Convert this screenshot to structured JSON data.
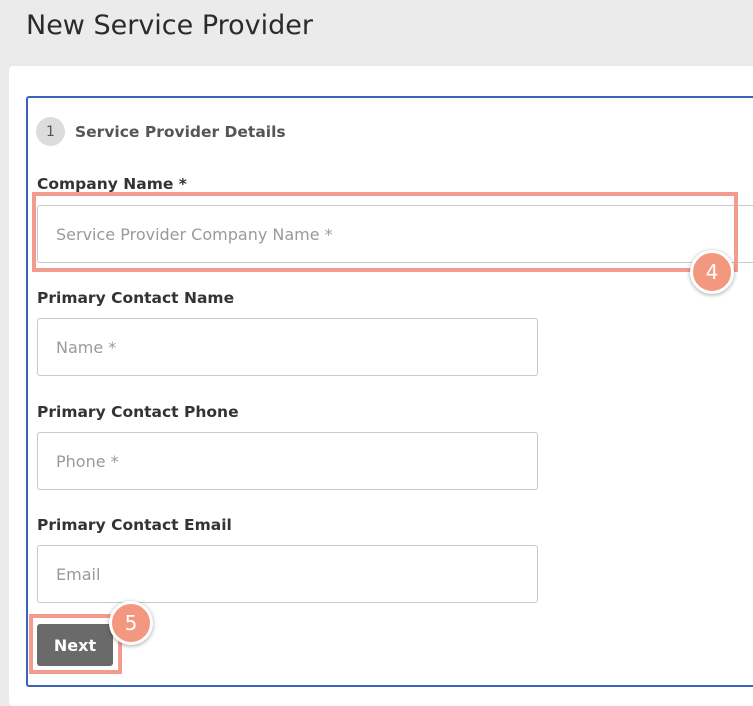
{
  "page": {
    "title": "New Service Provider"
  },
  "step": {
    "number": "1",
    "title": "Service Provider Details"
  },
  "form": {
    "company_name": {
      "label": "Company Name *",
      "placeholder": "Service Provider Company Name *",
      "value": ""
    },
    "contact_name": {
      "label": "Primary Contact Name",
      "placeholder": "Name *",
      "value": ""
    },
    "contact_phone": {
      "label": "Primary Contact Phone",
      "placeholder": "Phone *",
      "value": ""
    },
    "contact_email": {
      "label": "Primary Contact Email",
      "placeholder": "Email",
      "value": ""
    },
    "next_label": "Next"
  },
  "annotations": {
    "marker_company": "4",
    "marker_next": "5",
    "highlight_color": "#f49b8f",
    "marker_color": "#f4977f"
  },
  "colors": {
    "panel_border": "#3c63b8",
    "button_bg": "#6a6a6a"
  }
}
